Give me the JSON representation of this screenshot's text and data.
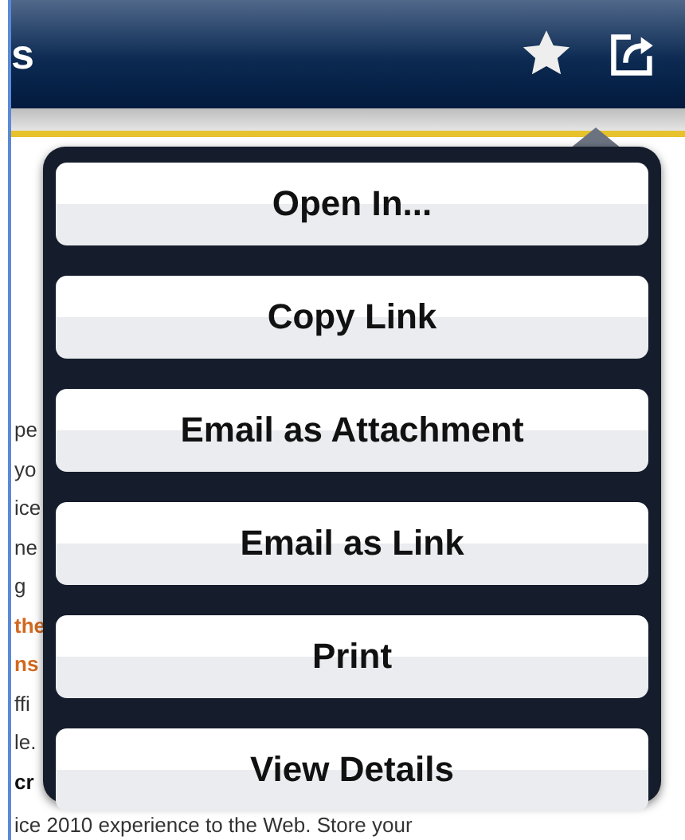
{
  "header": {
    "title_fragment": "s"
  },
  "page_fragments": [
    {
      "text": "pe",
      "kind": "normal"
    },
    {
      "text": "yo",
      "kind": "normal"
    },
    {
      "text": "ice",
      "kind": "normal"
    },
    {
      "text": "ne",
      "kind": "normal"
    },
    {
      "text": "g",
      "kind": "normal"
    },
    {
      "text": "the",
      "kind": "link"
    },
    {
      "text": "ns",
      "kind": "link"
    },
    {
      "text": "ffi",
      "kind": "normal"
    },
    {
      "text": "le.",
      "kind": "normal"
    },
    {
      "text": "cr",
      "kind": "bold"
    }
  ],
  "page_bottom_line": "ice 2010 experience to the Web. Store your",
  "share_menu": {
    "items": [
      "Open In...",
      "Copy Link",
      "Email as Attachment",
      "Email as Link",
      "Print",
      "View Details"
    ]
  }
}
